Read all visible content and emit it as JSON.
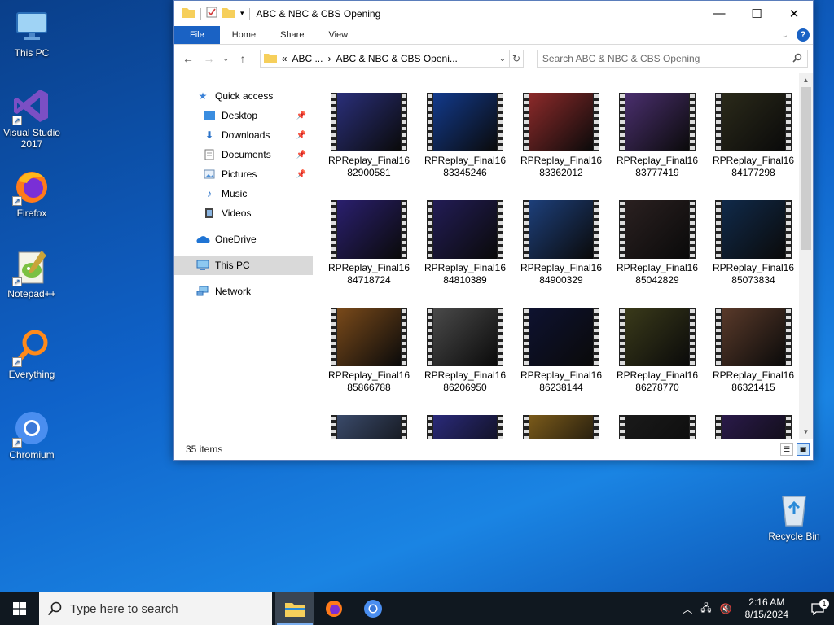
{
  "desktop": {
    "icons": [
      {
        "label": "This PC",
        "icon": "monitor-icon"
      },
      {
        "label": "Visual Studio 2017",
        "icon": "visual-studio-icon"
      },
      {
        "label": "Firefox",
        "icon": "firefox-icon"
      },
      {
        "label": "Notepad++",
        "icon": "notepadpp-icon"
      },
      {
        "label": "Everything",
        "icon": "everything-search-icon"
      },
      {
        "label": "Chromium",
        "icon": "chromium-icon"
      },
      {
        "label": "Recycle Bin",
        "icon": "recycle-bin-icon"
      }
    ]
  },
  "window": {
    "title": "ABC & NBC & CBS Opening",
    "ribbon_tabs": [
      "File",
      "Home",
      "Share",
      "View"
    ],
    "help_label": "?",
    "address": {
      "prefix": "«",
      "crumb1": "ABC ...",
      "crumb_sep": "›",
      "crumb2": "ABC & NBC & CBS Openi..."
    },
    "search_placeholder": "Search ABC & NBC & CBS Opening",
    "nav": [
      {
        "label": "Quick access",
        "icon": "star-icon",
        "pinned": false
      },
      {
        "label": "Desktop",
        "icon": "desktop-folder-icon",
        "pinned": true
      },
      {
        "label": "Downloads",
        "icon": "download-arrow-icon",
        "pinned": true
      },
      {
        "label": "Documents",
        "icon": "document-icon",
        "pinned": true
      },
      {
        "label": "Pictures",
        "icon": "pictures-icon",
        "pinned": true
      },
      {
        "label": "Music",
        "icon": "music-note-icon",
        "pinned": false
      },
      {
        "label": "Videos",
        "icon": "film-icon",
        "pinned": false
      },
      {
        "label": "OneDrive",
        "icon": "cloud-icon",
        "pinned": false
      },
      {
        "label": "This PC",
        "icon": "monitor-icon",
        "pinned": false,
        "selected": true
      },
      {
        "label": "Network",
        "icon": "network-icon",
        "pinned": false
      }
    ],
    "files": [
      {
        "name": "RPReplay_Final1682900581",
        "l1": "RPReplay_Final16",
        "l2": "82900581",
        "thumb": "#2a2f7a"
      },
      {
        "name": "RPReplay_Final1683345246",
        "l1": "RPReplay_Final16",
        "l2": "83345246",
        "thumb": "#123a8c"
      },
      {
        "name": "RPReplay_Final1683362012",
        "l1": "RPReplay_Final16",
        "l2": "83362012",
        "thumb": "#8c2a2a"
      },
      {
        "name": "RPReplay_Final1683777419",
        "l1": "RPReplay_Final16",
        "l2": "83777419",
        "thumb": "#4a2f6e"
      },
      {
        "name": "RPReplay_Final1684177298",
        "l1": "RPReplay_Final16",
        "l2": "84177298",
        "thumb": "#2b2a1a"
      },
      {
        "name": "RPReplay_Final1684718724",
        "l1": "RPReplay_Final16",
        "l2": "84718724",
        "thumb": "#2a1f6e"
      },
      {
        "name": "RPReplay_Final1684810389",
        "l1": "RPReplay_Final16",
        "l2": "84810389",
        "thumb": "#221c55"
      },
      {
        "name": "RPReplay_Final1684900329",
        "l1": "RPReplay_Final16",
        "l2": "84900329",
        "thumb": "#1d3f7a"
      },
      {
        "name": "RPReplay_Final1685042829",
        "l1": "RPReplay_Final16",
        "l2": "85042829",
        "thumb": "#2a2020"
      },
      {
        "name": "RPReplay_Final1685073834",
        "l1": "RPReplay_Final16",
        "l2": "85073834",
        "thumb": "#102a4a"
      },
      {
        "name": "RPReplay_Final1685866788",
        "l1": "RPReplay_Final16",
        "l2": "85866788",
        "thumb": "#7a4a1a"
      },
      {
        "name": "RPReplay_Final1686206950",
        "l1": "RPReplay_Final16",
        "l2": "86206950",
        "thumb": "#4a4a4a"
      },
      {
        "name": "RPReplay_Final1686238144",
        "l1": "RPReplay_Final16",
        "l2": "86238144",
        "thumb": "#0e1230"
      },
      {
        "name": "RPReplay_Final1686278770",
        "l1": "RPReplay_Final16",
        "l2": "86278770",
        "thumb": "#3a3a1a"
      },
      {
        "name": "RPReplay_Final1686321415",
        "l1": "RPReplay_Final16",
        "l2": "86321415",
        "thumb": "#5a3a2a"
      },
      {
        "name": "",
        "l1": "",
        "l2": "",
        "thumb": "#3a4a6a"
      },
      {
        "name": "",
        "l1": "",
        "l2": "",
        "thumb": "#2a2a7a"
      },
      {
        "name": "",
        "l1": "",
        "l2": "",
        "thumb": "#7a5a1a"
      },
      {
        "name": "",
        "l1": "",
        "l2": "",
        "thumb": "#1a1a1a"
      },
      {
        "name": "",
        "l1": "",
        "l2": "",
        "thumb": "#2a1a4a"
      }
    ],
    "status_text": "35 items"
  },
  "taskbar": {
    "search_placeholder": "Type here to search",
    "time": "2:16 AM",
    "date": "8/15/2024",
    "notification_count": "1"
  },
  "colors": {
    "accent": "#1a62c4",
    "taskbar": "#101820",
    "selection": "#d9d9d9"
  }
}
